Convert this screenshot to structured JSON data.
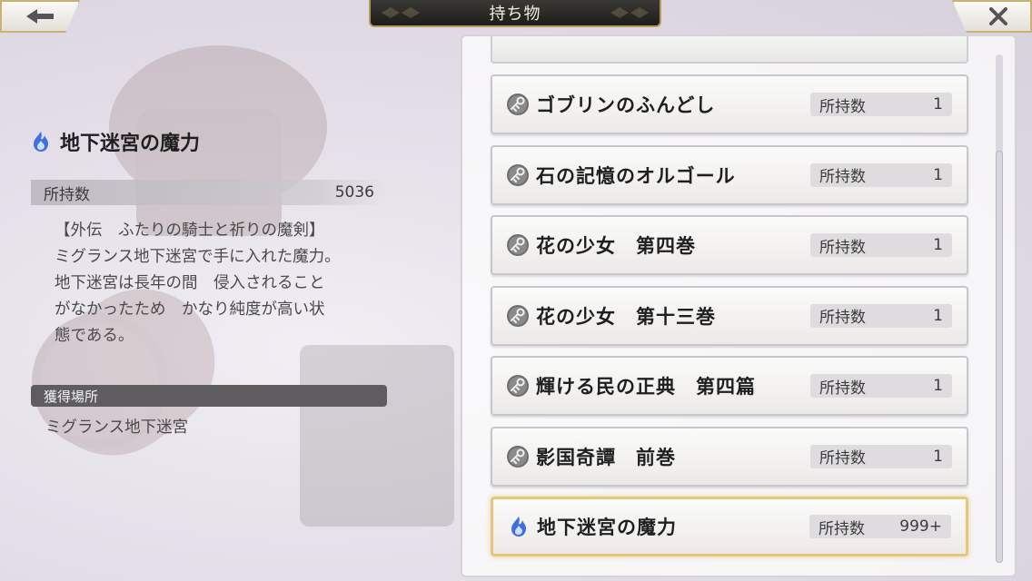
{
  "header": {
    "title": "持ち物"
  },
  "nav": {
    "back_icon": "arrow-left-icon",
    "close_icon": "close-icon"
  },
  "detail": {
    "name": "地下迷宮の魔力",
    "icon": "blue-flame-icon",
    "count_label": "所持数",
    "count_value": "5036",
    "description": "【外伝　ふたりの騎士と祈りの魔剣】\nミグランス地下迷宮で手に入れた魔力。\n地下迷宮は長年の間　侵入されること\nがなかったため　かなり純度が高い状\n態である。",
    "source_label": "獲得場所",
    "source_value": "ミグランス地下迷宮"
  },
  "items": [
    {
      "name": "ゴブリンのふんどし",
      "count_label": "所持数",
      "count": "1",
      "icon": "key-icon"
    },
    {
      "name": "石の記憶のオルゴール",
      "count_label": "所持数",
      "count": "1",
      "icon": "key-icon"
    },
    {
      "name": "花の少女　第四巻",
      "count_label": "所持数",
      "count": "1",
      "icon": "key-icon"
    },
    {
      "name": "花の少女　第十三巻",
      "count_label": "所持数",
      "count": "1",
      "icon": "key-icon"
    },
    {
      "name": "輝ける民の正典　第四篇",
      "count_label": "所持数",
      "count": "1",
      "icon": "key-icon"
    },
    {
      "name": "影国奇譚　前巻",
      "count_label": "所持数",
      "count": "1",
      "icon": "key-icon"
    },
    {
      "name": "地下迷宮の魔力",
      "count_label": "所持数",
      "count": "999+",
      "icon": "blue-flame-icon",
      "selected": true
    }
  ],
  "colors": {
    "selected_border": "#e6c67a",
    "header_bg": "#2b2a27",
    "flame": "#3f6fe0"
  }
}
